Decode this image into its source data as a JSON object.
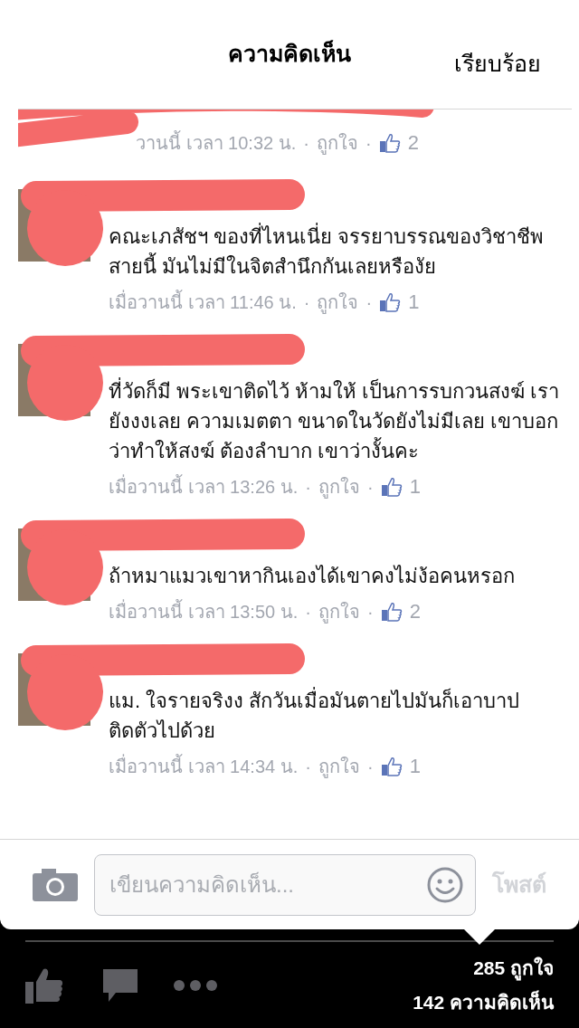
{
  "header": {
    "title": "ความคิดเห็น",
    "done_button": "เรียบร้อย"
  },
  "comments": [
    {
      "time": "วานนี้ เวลา 10:32 น.",
      "separator": "·",
      "like_label": "ถูกใจ",
      "likes": "2"
    },
    {
      "text": "คณะเภสัชฯ ของที่ไหนเนี่ย จรรยาบรรณของวิชาชีพ สายนี้ มันไม่มีในจิตสำนึกกันเลยหรืองัย",
      "time": "เมื่อวานนี้ เวลา 11:46 น.",
      "separator": "·",
      "like_label": "ถูกใจ",
      "likes": "1"
    },
    {
      "text": "ที่วัดก็มี พระเขาติดไว้ ห้ามให้ เป็นการรบกวนสงฆ์ เรายังงงเลย ความเมตตา ขนาดในวัดยังไม่มีเลย เขาบอกว่าทำให้สงฆ์ ต้องลำบาก เขาว่างั้นคะ",
      "time": "เมื่อวานนี้ เวลา 13:26 น.",
      "separator": "·",
      "like_label": "ถูกใจ",
      "likes": "1"
    },
    {
      "text": "ถ้าหมาแมวเขาหากินเองได้เขาคงไม่ง้อคนหรอก",
      "time": "เมื่อวานนี้ เวลา 13:50 น.",
      "separator": "·",
      "like_label": "ถูกใจ",
      "likes": "2"
    },
    {
      "text": "แม. ใจรายจริงง สักวันเมื่อมันตายไปมันก็เอาบาป ติดตัวไปด้วย",
      "time": "เมื่อวานนี้ เวลา 14:34 น.",
      "separator": "·",
      "like_label": "ถูกใจ",
      "likes": "1"
    }
  ],
  "composer": {
    "placeholder": "เขียนความคิดเห็น...",
    "post_button": "โพสต์",
    "post_disabled": true
  },
  "footer": {
    "likes": "285 ถูกใจ",
    "comments": "142 ความคิดเห็น"
  }
}
